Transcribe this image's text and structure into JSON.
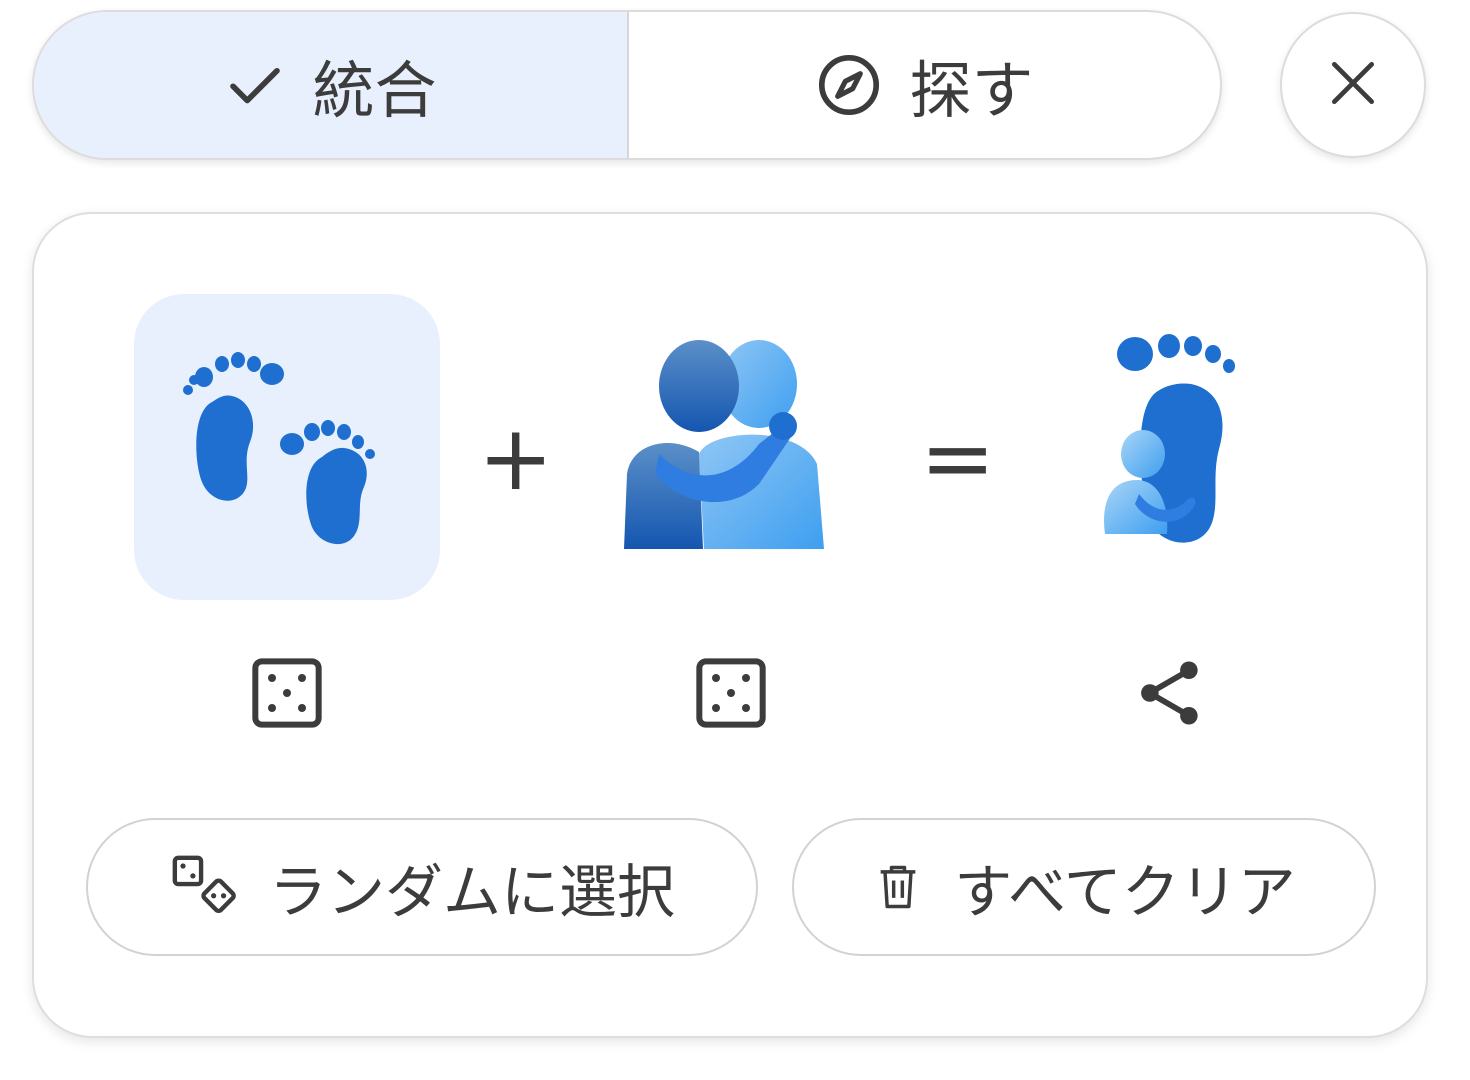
{
  "mode_tabs": {
    "merge_label": "統合",
    "explore_label": "探す",
    "active": "merge"
  },
  "header": {
    "close_icon": "close-icon"
  },
  "mixer": {
    "first_emoji": "footprints",
    "second_emoji": "people-hugging",
    "result_emoji": "footprint-hugging",
    "plus_sign": "+",
    "equals_sign": "=",
    "first_randomize_icon": "dice-icon",
    "second_randomize_icon": "dice-icon",
    "share_icon": "share-icon"
  },
  "actions": {
    "random_label": "ランダムに選択",
    "clear_label": "すべてクリア"
  },
  "colors": {
    "active_tab_bg": "#e8f0fe",
    "emoji_blue_dark": "#1565c0",
    "emoji_blue_light": "#42a5f5",
    "text": "#3c3c3c"
  }
}
